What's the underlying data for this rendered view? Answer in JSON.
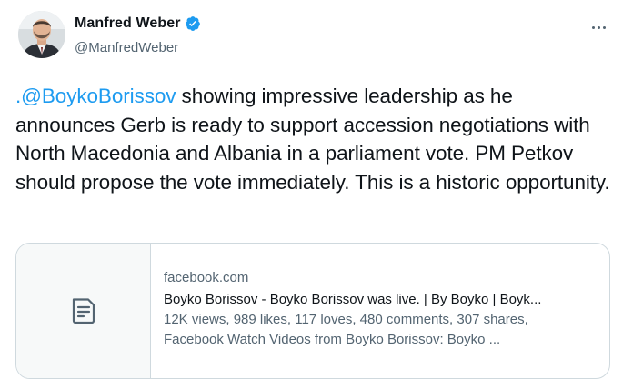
{
  "author": {
    "display_name": "Manfred Weber",
    "handle": "@ManfredWeber",
    "verified": true
  },
  "tweet": {
    "mention": ".@BoykoBorissov",
    "text_after_mention": " showing impressive leadership as he announces Gerb is ready to support accession negotiations with North Macedonia and Albania in a parliament vote. PM Petkov should propose the vote immediately. This is a historic opportunity."
  },
  "link_card": {
    "domain": "facebook.com",
    "title": "Boyko Borissov - Boyko Borissov was live. | By Boyko | Boyk...",
    "description_line1": "12K views, 989 likes, 117 loves, 480 comments, 307 shares,",
    "description_line2": "Facebook Watch Videos from Boyko Borissov: Boyko ...",
    "thumbnail_icon": "document-icon"
  },
  "icons": {
    "verified": "verified-badge-icon",
    "more": "more-options-icon"
  },
  "colors": {
    "accent": "#1d9bf0",
    "text": "#0f1419",
    "secondary": "#536471",
    "border": "#cfd9de"
  }
}
